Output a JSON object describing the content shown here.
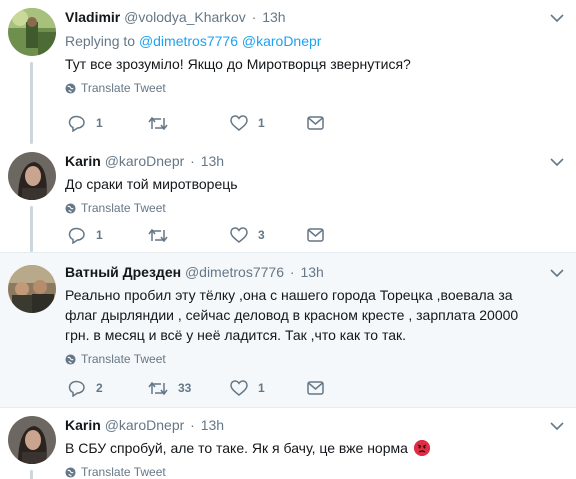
{
  "tweets": [
    {
      "name": "Vladimir",
      "handle": "@volodya_Kharkov",
      "time": "13h",
      "reply_prefix": "Replying to",
      "reply_users": "@dimetros7776 @karoDnepr",
      "text": "Тут все зрозуміло! Якщо до Миротворця звернутися?",
      "translate": "Translate Tweet",
      "replies": "1",
      "retweets": "",
      "likes": "1"
    },
    {
      "name": "Karin",
      "handle": "@karoDnepr",
      "time": "13h",
      "text": "До сраки той миротворець",
      "translate": "Translate Tweet",
      "replies": "1",
      "retweets": "",
      "likes": "3"
    },
    {
      "name": "Ватный Дрезден",
      "handle": "@dimetros7776",
      "time": "13h",
      "text": "Реально пробил эту тёлку ,она с нашего города Торецка ,воевала за флаг дырляндии , сейчас деловод в красном кресте , зарплата 20000 грн. в месяц и всё у неё ладится. Так ,что как то так.",
      "translate": "Translate Tweet",
      "replies": "2",
      "retweets": "33",
      "likes": "1"
    },
    {
      "name": "Karin",
      "handle": "@karoDnepr",
      "time": "13h",
      "text": "В СБУ спробуй, але то таке. Як я бачу, це вже норма",
      "translate": "Translate Tweet"
    }
  ],
  "dot": "·",
  "colors": {
    "link": "#1da1f2",
    "muted": "#657786",
    "highlight_bg": "#f5f8fa"
  }
}
